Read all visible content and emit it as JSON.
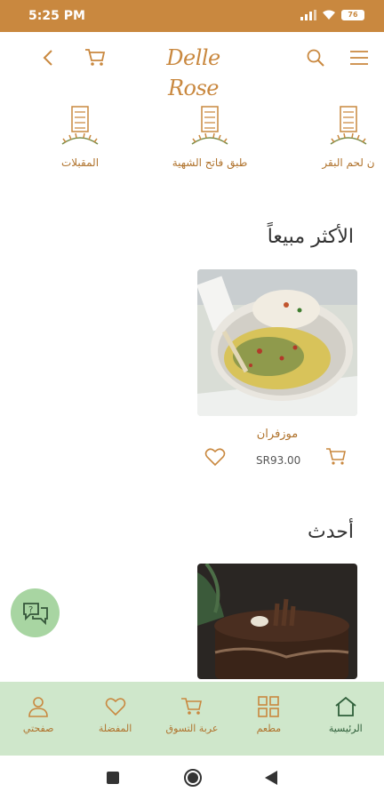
{
  "status": {
    "time": "5:25 PM",
    "battery": "76"
  },
  "header": {
    "logo_text": "Delle Rose"
  },
  "categories": [
    {
      "label": "المقبلات"
    },
    {
      "label": "طبق فاتح الشهية"
    },
    {
      "label": "ن لحم البقر"
    }
  ],
  "bestsellers": {
    "title": "الأكثر مبيعاً",
    "products": [
      {
        "name": "موزفران",
        "price": "SR93.00"
      }
    ]
  },
  "latest": {
    "title": "أحدث"
  },
  "bottom_nav": [
    {
      "label": "الرئيسية"
    },
    {
      "label": "مطعم"
    },
    {
      "label": "عربة التسوق"
    },
    {
      "label": "المفضلة"
    },
    {
      "label": "صفحتي"
    }
  ],
  "colors": {
    "brand": "#c9883f",
    "nav_bg": "#cfe7cb",
    "fab_bg": "#a8d5a2"
  }
}
